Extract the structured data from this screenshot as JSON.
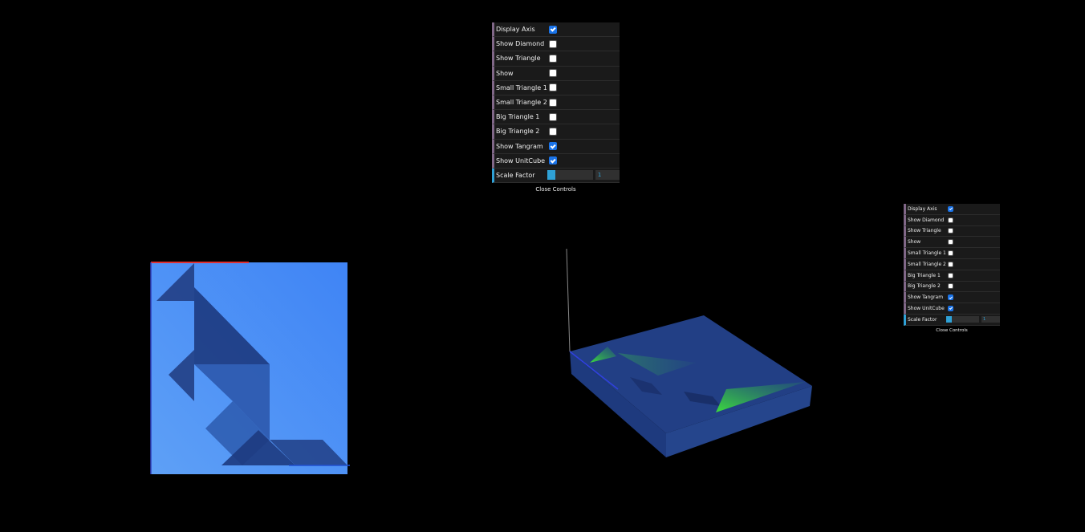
{
  "gui_main": {
    "controls": [
      {
        "label": "Display Axis",
        "checked": true
      },
      {
        "label": "Show Diamond",
        "checked": false
      },
      {
        "label": "Show Triangle",
        "checked": false
      },
      {
        "label": "Show",
        "checked": false
      },
      {
        "label": "Small Triangle 1",
        "checked": false
      },
      {
        "label": "Small Triangle 2",
        "checked": false
      },
      {
        "label": "Big Triangle 1",
        "checked": false
      },
      {
        "label": "Big Triangle 2",
        "checked": false
      },
      {
        "label": "Show Tangram",
        "checked": true
      },
      {
        "label": "Show UnitCube",
        "checked": true
      }
    ],
    "scale": {
      "label": "Scale Factor",
      "value": "1",
      "fill_fraction": 0.18
    },
    "close_label": "Close Controls"
  },
  "gui_mini": {
    "controls": [
      {
        "label": "Display Axis",
        "checked": true
      },
      {
        "label": "Show Diamond",
        "checked": false
      },
      {
        "label": "Show Triangle",
        "checked": false
      },
      {
        "label": "Show",
        "checked": false
      },
      {
        "label": "Small Triangle 1",
        "checked": false
      },
      {
        "label": "Small Triangle 2",
        "checked": false
      },
      {
        "label": "Big Triangle 1",
        "checked": false
      },
      {
        "label": "Big Triangle 2",
        "checked": false
      },
      {
        "label": "Show Tangram",
        "checked": true
      },
      {
        "label": "Show UnitCube",
        "checked": true
      }
    ],
    "scale": {
      "label": "Scale Factor",
      "value": "1",
      "fill_fraction": 0.18
    },
    "close_label": "Close Controls"
  },
  "colors": {
    "background": "#000000",
    "cube_face": "#4a90f0",
    "tangram_piece": "#1f3f8a",
    "tangram_highlight": "#3ddc3d",
    "axis_x": "#e03030",
    "axis_y": "#30c030",
    "axis_z": "#3030e0",
    "checkbox_checked": "#1a73e8",
    "slider_fill": "#2fa1d6"
  }
}
